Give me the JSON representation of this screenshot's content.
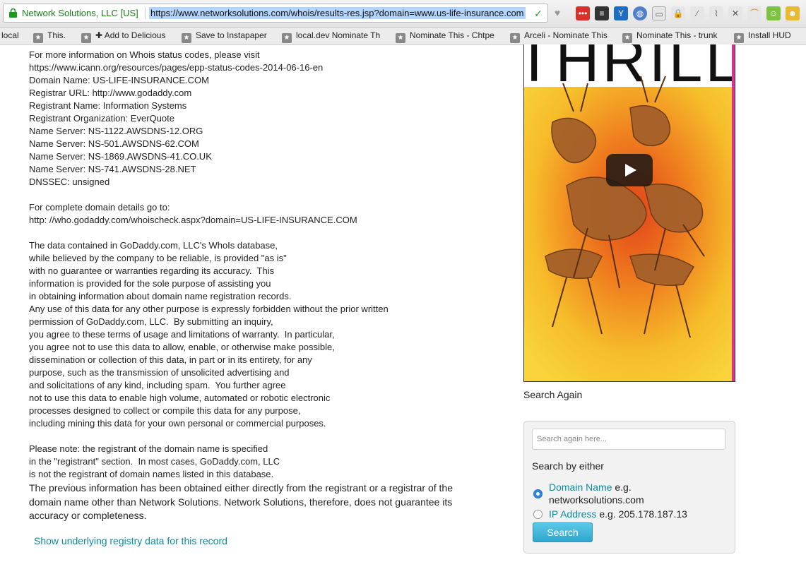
{
  "browser": {
    "site_identity": "Network Solutions, LLC [US]",
    "url": "https://www.networksolutions.com/whois/results-res.jsp?domain=www.us-life-insurance.com",
    "bookmarks": [
      {
        "label": "local",
        "icon": "folder-icon"
      },
      {
        "label": "This.",
        "icon": "bookmark-icon"
      },
      {
        "label": "✚ Add to Delicious",
        "icon": "bookmark-icon"
      },
      {
        "label": "Save to Instapaper",
        "icon": "bookmark-icon"
      },
      {
        "label": "local.dev Nominate Th",
        "icon": "bookmark-icon"
      },
      {
        "label": "Nominate This - Chtpe",
        "icon": "bookmark-icon"
      },
      {
        "label": "Arceli - Nominate This",
        "icon": "bookmark-icon"
      },
      {
        "label": "Nominate This - trunk",
        "icon": "bookmark-icon"
      },
      {
        "label": "Install HUD",
        "icon": "bookmark-icon"
      }
    ]
  },
  "whois": {
    "lines": [
      "For more information on Whois status codes, please visit",
      "https://www.icann.org/resources/pages/epp-status-codes-2014-06-16-en",
      "Domain Name: US-LIFE-INSURANCE.COM",
      "Registrar URL: http://www.godaddy.com",
      "Registrant Name: Information Systems",
      "Registrant Organization: EverQuote",
      "Name Server: NS-1122.AWSDNS-12.ORG",
      "Name Server: NS-501.AWSDNS-62.COM",
      "Name Server: NS-1869.AWSDNS-41.CO.UK",
      "Name Server: NS-741.AWSDNS-28.NET",
      "DNSSEC: unsigned",
      "",
      "For complete domain details go to:",
      "http: //who.godaddy.com/whoischeck.aspx?domain=US-LIFE-INSURANCE.COM",
      "",
      "The data contained in GoDaddy.com, LLC's WhoIs database,",
      "while believed by the company to be reliable, is provided \"as is\"",
      "with no guarantee or warranties regarding its accuracy.  This",
      "information is provided for the sole purpose of assisting you",
      "in obtaining information about domain name registration records.",
      "Any use of this data for any other purpose is expressly forbidden without the prior written",
      "permission of GoDaddy.com, LLC.  By submitting an inquiry,",
      "you agree to these terms of usage and limitations of warranty.  In particular,",
      "you agree not to use this data to allow, enable, or otherwise make possible,",
      "dissemination or collection of this data, in part or in its entirety, for any",
      "purpose, such as the transmission of unsolicited advertising and",
      "and solicitations of any kind, including spam.  You further agree",
      "not to use this data to enable high volume, automated or robotic electronic",
      "processes designed to collect or compile this data for any purpose,",
      "including mining this data for your own personal or commercial purposes.",
      "",
      "Please note: the registrant of the domain name is specified",
      "in the \"registrant\" section.  In most cases, GoDaddy.com, LLC",
      "is not the registrant of domain names listed in this database."
    ],
    "disclaimer": "The previous information has been obtained either directly from the registrant or a registrar of the domain name other than Network Solutions. Network Solutions, therefore, does not guarantee its accuracy or completeness.",
    "underlying_link": "Show underlying registry data for this record"
  },
  "ad": {
    "headline": "THRILL"
  },
  "search_again": {
    "label": "Search Again",
    "placeholder": "Search again here...",
    "by_either": "Search by either",
    "options": [
      {
        "name": "Domain Name",
        "example": "e.g. networksolutions.com",
        "selected": true
      },
      {
        "name": "IP Address",
        "example": "e.g. 205.178.187.13",
        "selected": false
      }
    ],
    "button": "Search"
  },
  "colors": {
    "link": "#0e8aa0",
    "button": "#2ea7cf",
    "radio_selected": "#2f86e0",
    "url_selection": "#b3d4fd"
  }
}
